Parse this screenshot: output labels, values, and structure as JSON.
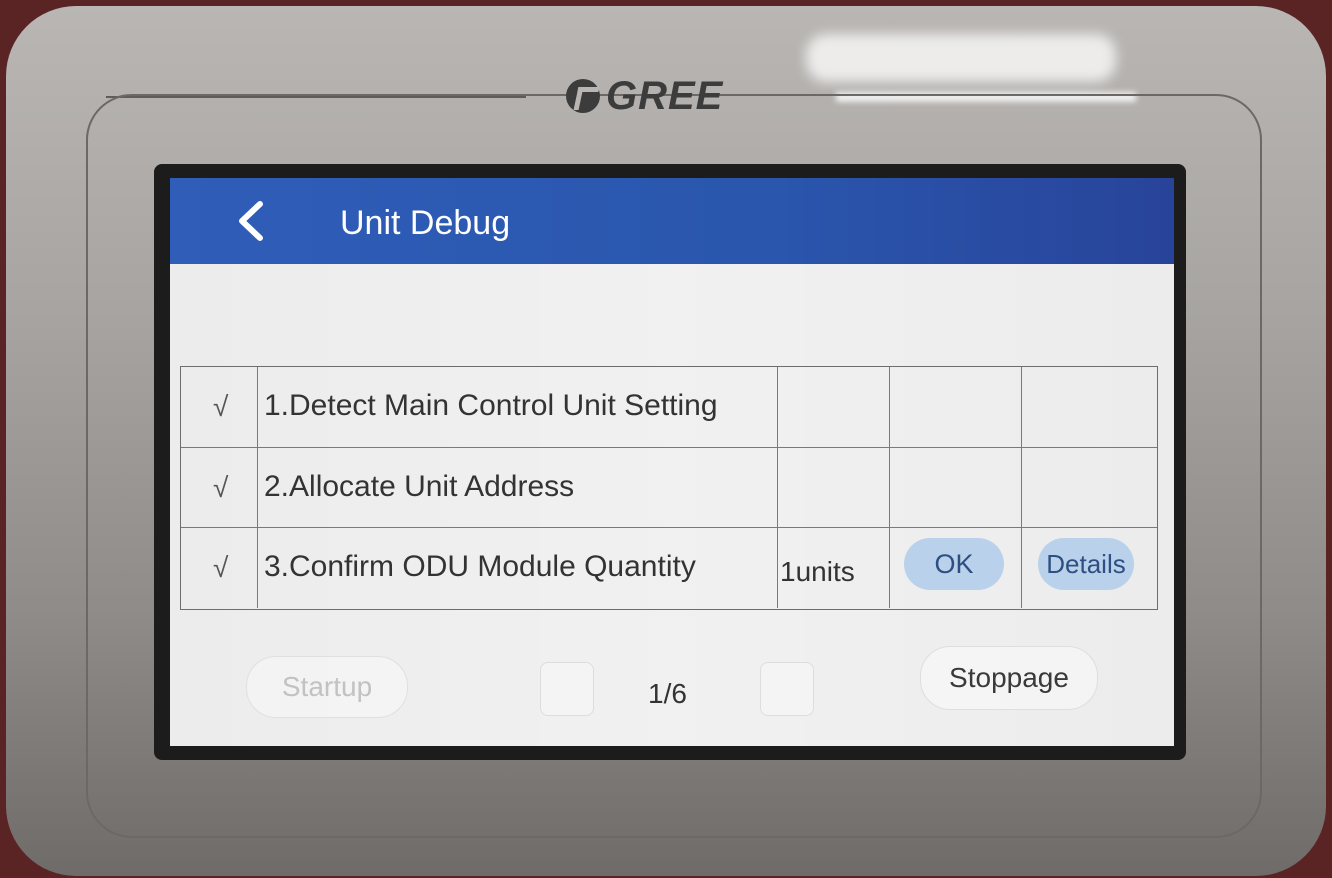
{
  "brand": {
    "logo_text": "GREE"
  },
  "header": {
    "title": "Unit Debug",
    "back_icon": "chevron-left-icon"
  },
  "colors": {
    "header_bg": "#2f5db8",
    "pill_bg": "#b9d1ea",
    "screen_bg": "#ececec"
  },
  "steps": [
    {
      "check": "√",
      "label": "1.Detect Main Control Unit Setting",
      "value": "",
      "ok": "",
      "details": ""
    },
    {
      "check": "√",
      "label": "2.Allocate Unit Address",
      "value": "",
      "ok": "",
      "details": ""
    },
    {
      "check": "√",
      "label": "3.Confirm ODU Module Quantity",
      "value": "1units",
      "ok": "OK",
      "details": "Details"
    }
  ],
  "footer": {
    "startup_label": "Startup",
    "page_indicator": "1/6",
    "stoppage_label": "Stoppage"
  }
}
